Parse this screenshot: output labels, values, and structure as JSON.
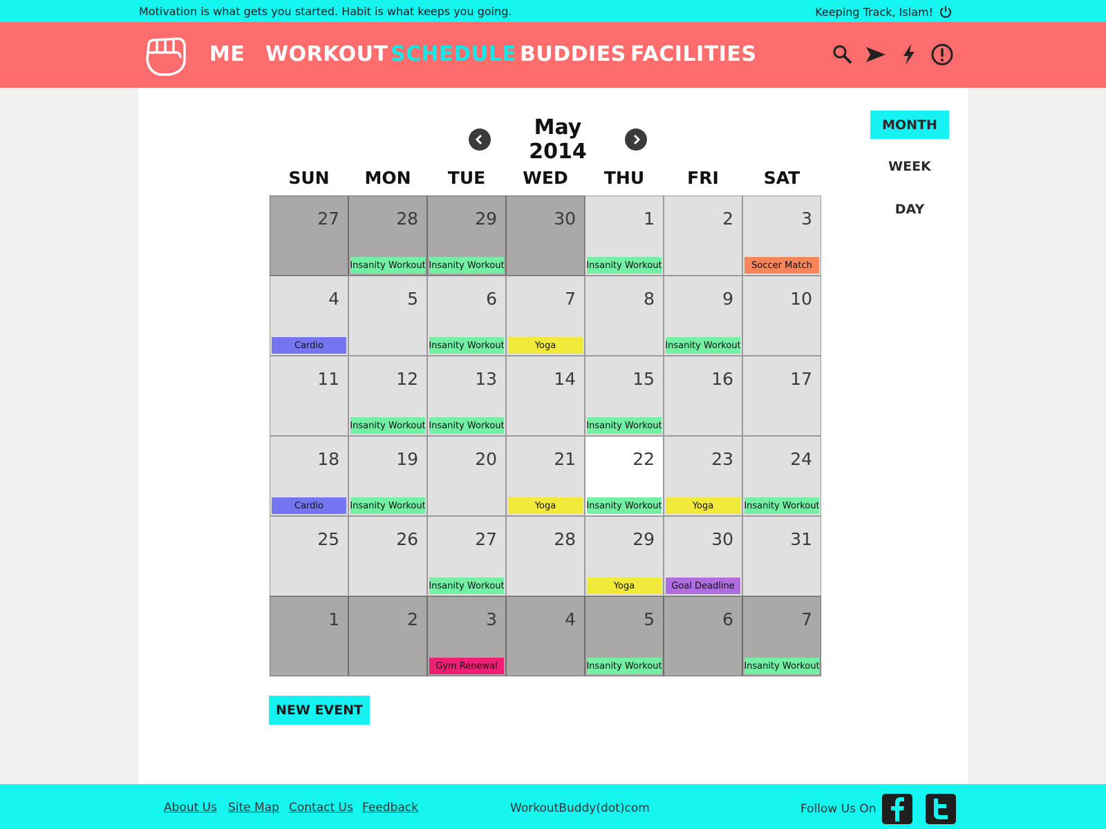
{
  "topbar": {
    "motto": "Motivation is what gets you started. Habit is what keeps you going.",
    "user_text": "Keeping Track, Islam!"
  },
  "nav": {
    "items": [
      "ME",
      "WORKOUT",
      "SCHEDULE",
      "BUDDIES",
      "FACILITIES"
    ],
    "active": "SCHEDULE",
    "icons": [
      "search-icon",
      "send-icon",
      "lightning-icon",
      "alert-icon"
    ]
  },
  "calendar": {
    "month_title": "May 2014",
    "views": [
      "MONTH",
      "WEEK",
      "DAY"
    ],
    "active_view": "MONTH",
    "weekdays": [
      "SUN",
      "MON",
      "TUE",
      "WED",
      "THU",
      "FRI",
      "SAT"
    ],
    "weeks": [
      [
        {
          "day": "27",
          "other": true
        },
        {
          "day": "28",
          "other": true,
          "event": "Insanity Workout",
          "type": "insanity"
        },
        {
          "day": "29",
          "other": true,
          "event": "Insanity Workout",
          "type": "insanity"
        },
        {
          "day": "30",
          "other": true
        },
        {
          "day": "1",
          "event": "Insanity Workout",
          "type": "insanity"
        },
        {
          "day": "2"
        },
        {
          "day": "3",
          "event": "Soccer Match",
          "type": "soccer"
        }
      ],
      [
        {
          "day": "4",
          "event": "Cardio",
          "type": "cardio"
        },
        {
          "day": "5"
        },
        {
          "day": "6",
          "event": "Insanity Workout",
          "type": "insanity"
        },
        {
          "day": "7",
          "event": "Yoga",
          "type": "yoga"
        },
        {
          "day": "8"
        },
        {
          "day": "9",
          "event": "Insanity Workout",
          "type": "insanity"
        },
        {
          "day": "10"
        }
      ],
      [
        {
          "day": "11"
        },
        {
          "day": "12",
          "event": "Insanity Workout",
          "type": "insanity"
        },
        {
          "day": "13",
          "event": "Insanity Workout",
          "type": "insanity"
        },
        {
          "day": "14"
        },
        {
          "day": "15",
          "event": "Insanity Workout",
          "type": "insanity"
        },
        {
          "day": "16"
        },
        {
          "day": "17"
        }
      ],
      [
        {
          "day": "18",
          "event": "Cardio",
          "type": "cardio"
        },
        {
          "day": "19",
          "event": "Insanity Workout",
          "type": "insanity"
        },
        {
          "day": "20"
        },
        {
          "day": "21",
          "event": "Yoga",
          "type": "yoga"
        },
        {
          "day": "22",
          "today": true,
          "event": "Insanity Workout",
          "type": "insanity"
        },
        {
          "day": "23",
          "event": "Yoga",
          "type": "yoga"
        },
        {
          "day": "24",
          "event": "Insanity Workout",
          "type": "insanity"
        }
      ],
      [
        {
          "day": "25"
        },
        {
          "day": "26"
        },
        {
          "day": "27",
          "event": "Insanity Workout",
          "type": "insanity"
        },
        {
          "day": "28"
        },
        {
          "day": "29",
          "event": "Yoga",
          "type": "yoga"
        },
        {
          "day": "30",
          "event": "Goal Deadline",
          "type": "goal"
        },
        {
          "day": "31"
        }
      ],
      [
        {
          "day": "1",
          "other": true
        },
        {
          "day": "2",
          "other": true
        },
        {
          "day": "3",
          "other": true,
          "event": "Gym Renewal",
          "type": "gym"
        },
        {
          "day": "4",
          "other": true
        },
        {
          "day": "5",
          "other": true,
          "event": "Insanity Workout",
          "type": "insanity"
        },
        {
          "day": "6",
          "other": true
        },
        {
          "day": "7",
          "other": true,
          "event": "Insanity Workout",
          "type": "insanity"
        }
      ]
    ],
    "event_colors": {
      "insanity": "#74f0a5",
      "cardio": "#7575f2",
      "yoga": "#f2ea3a",
      "soccer": "#f8845a",
      "goal": "#b06de0",
      "gym": "#ee1f75"
    },
    "new_event_label": "NEW EVENT"
  },
  "footer": {
    "links": [
      "About Us",
      "Site Map",
      "Contact Us",
      "Feedback"
    ],
    "site": "WorkoutBuddy(dot)com",
    "follow": "Follow Us On",
    "social": [
      "facebook-icon",
      "twitter-icon"
    ]
  },
  "colors": {
    "accent": "#16f6f1",
    "nav_bg": "#fe6d6d"
  }
}
